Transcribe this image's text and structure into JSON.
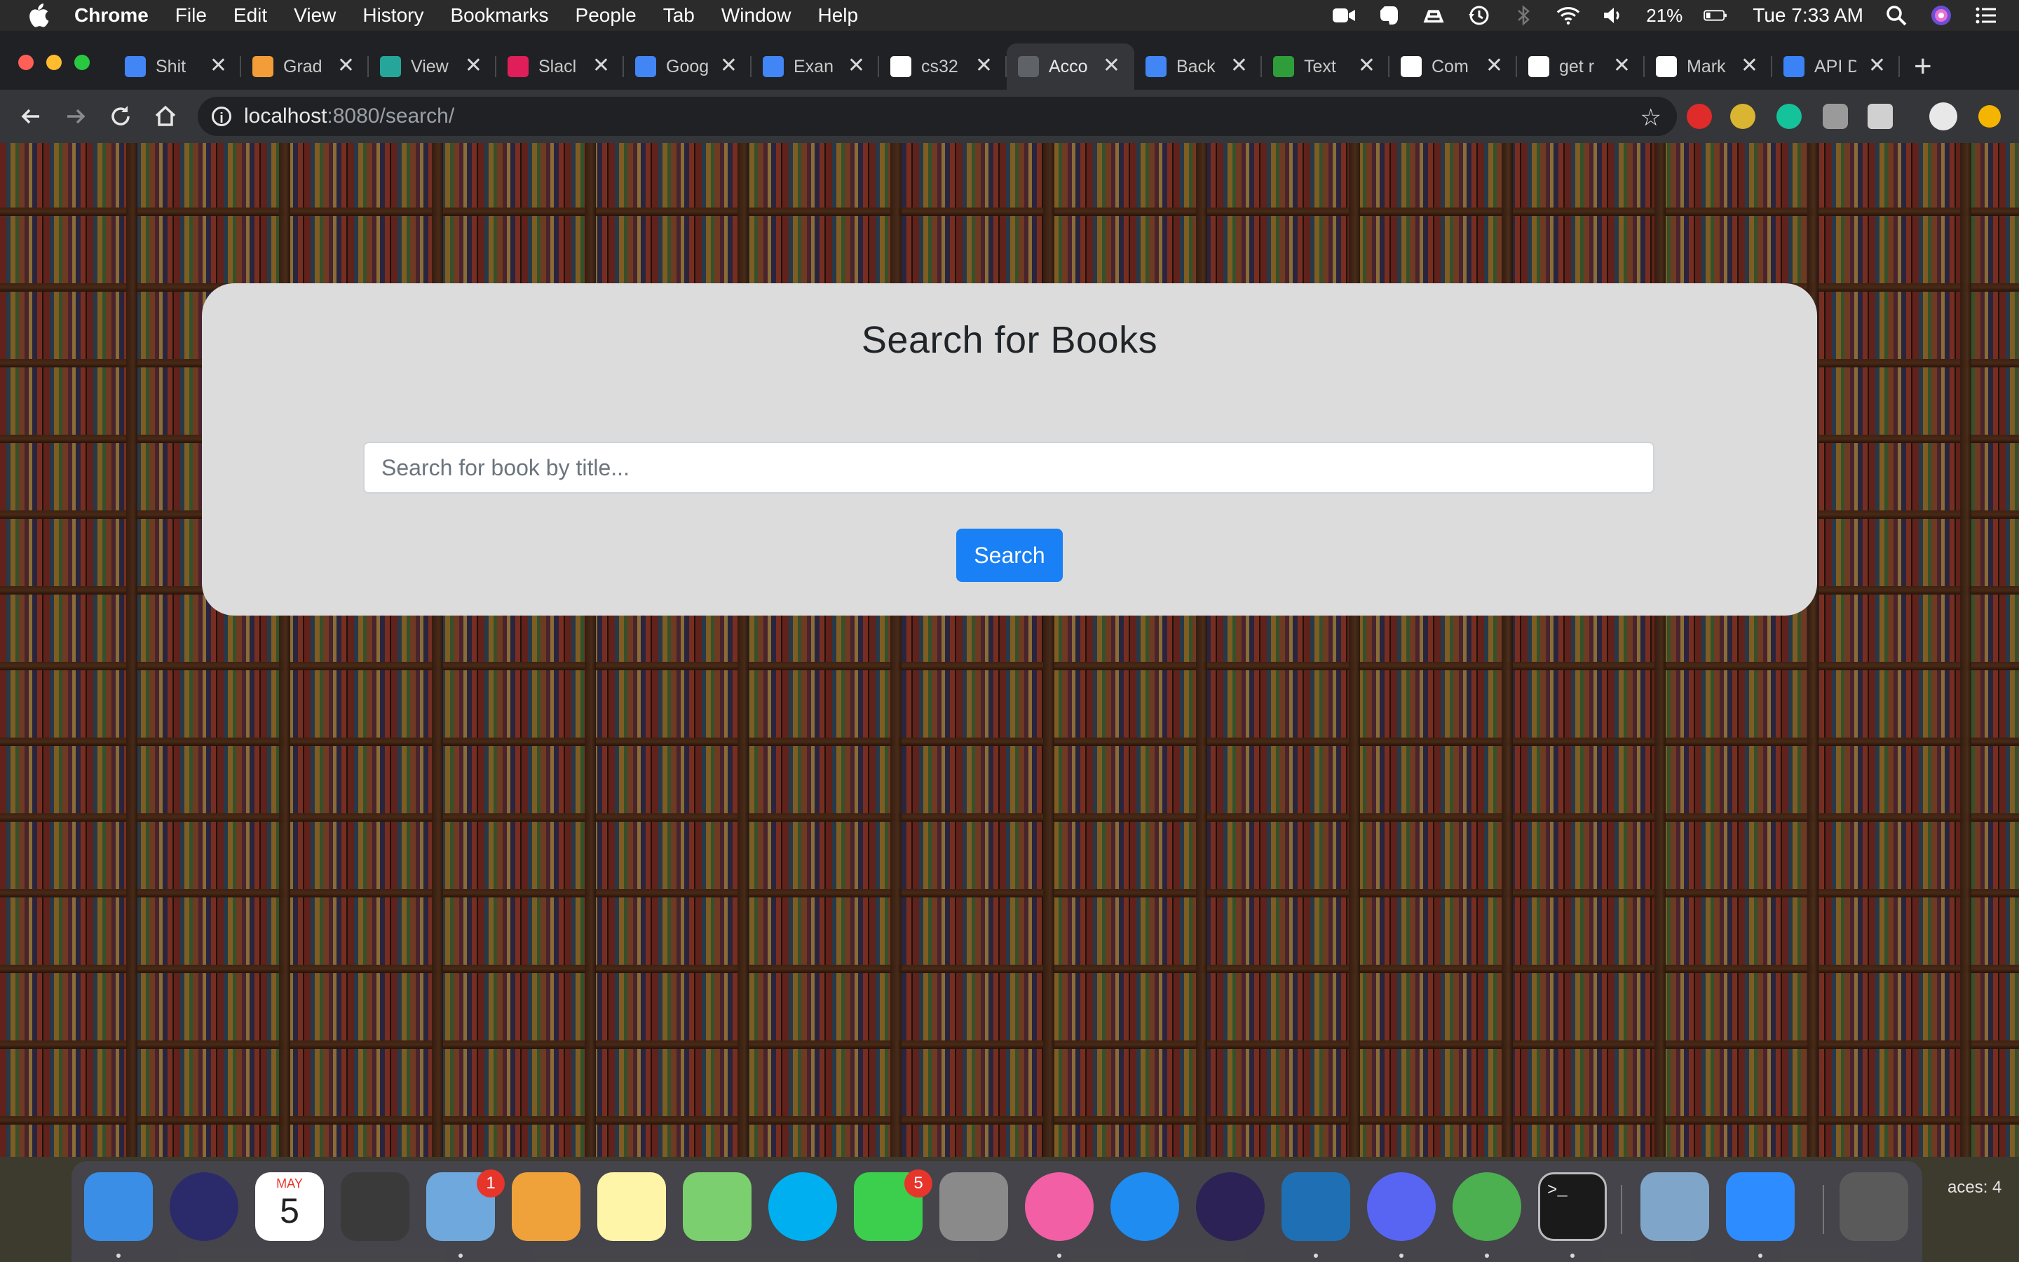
{
  "menubar": {
    "app_name": "Chrome",
    "menus": [
      "File",
      "Edit",
      "View",
      "History",
      "Bookmarks",
      "People",
      "Tab",
      "Window",
      "Help"
    ],
    "battery_percent": "21%",
    "clock": "Tue 7:33 AM",
    "status_icons": [
      "zoom-video-icon",
      "evernote-icon",
      "drive-sync-icon",
      "time-machine-icon",
      "bluetooth-icon",
      "wifi-icon",
      "volume-icon",
      "battery-icon",
      "spotlight-icon",
      "siri-icon",
      "notification-center-icon"
    ]
  },
  "browser": {
    "tabs": [
      {
        "label": "Shit",
        "icon": "google-docs-icon",
        "color": "#4285f4"
      },
      {
        "label": "Grad",
        "icon": "gradescope-icon",
        "color": "#f29d38"
      },
      {
        "label": "View",
        "icon": "analytics-icon",
        "color": "#26a69a"
      },
      {
        "label": "Slacl",
        "icon": "slack-icon",
        "color": "#e01e5a"
      },
      {
        "label": "Goog",
        "icon": "google-docs-icon",
        "color": "#4285f4"
      },
      {
        "label": "Exan",
        "icon": "google-docs-icon",
        "color": "#4285f4"
      },
      {
        "label": "cs32",
        "icon": "github-icon",
        "color": "#ffffff"
      },
      {
        "label": "Acco",
        "icon": "globe-icon",
        "color": "#5f6368",
        "active": true
      },
      {
        "label": "Back",
        "icon": "google-docs-icon",
        "color": "#4285f4"
      },
      {
        "label": "Text",
        "icon": "leaf-icon",
        "color": "#2e9d3a"
      },
      {
        "label": "Com",
        "icon": "github-icon",
        "color": "#ffffff"
      },
      {
        "label": "get r",
        "icon": "google-icon",
        "color": "#ffffff"
      },
      {
        "label": "Mark",
        "icon": "github-icon",
        "color": "#ffffff"
      },
      {
        "label": "API D",
        "icon": "api-docs-icon",
        "color": "#3b82f6"
      }
    ],
    "tab_close_glyph": "✕",
    "new_tab_glyph": "+",
    "url_host": "localhost",
    "url_path": ":8080/search/",
    "extensions": [
      "adblock-icon",
      "extension-yellow-icon",
      "grammarly-icon",
      "extension-grey-icon",
      "extension-tabs-icon"
    ]
  },
  "page": {
    "title": "Search for Books",
    "search": {
      "placeholder": "Search for book by title...",
      "value": ""
    },
    "search_button": "Search"
  },
  "dock": {
    "apps": [
      {
        "name": "finder-icon",
        "color": "#3a8ee6",
        "running": true
      },
      {
        "name": "siri-icon",
        "color": "#2b2b6b",
        "running": false
      },
      {
        "name": "calendar-icon",
        "color": "#ffffff",
        "running": false
      },
      {
        "name": "mission-control-icon",
        "color": "#3a3a3a",
        "running": false
      },
      {
        "name": "mail-icon",
        "color": "#6fa8dc",
        "running": true,
        "badge": "1"
      },
      {
        "name": "pages-icon",
        "color": "#f0a23a",
        "running": false
      },
      {
        "name": "notes-icon",
        "color": "#fff5a8",
        "running": false
      },
      {
        "name": "maps-icon",
        "color": "#7ccf6e",
        "running": false
      },
      {
        "name": "skype-icon",
        "color": "#00aff0",
        "running": false
      },
      {
        "name": "facetime-icon",
        "color": "#3ccf4e",
        "running": false,
        "badge": "5"
      },
      {
        "name": "system-preferences-icon",
        "color": "#8a8a8a",
        "running": false
      },
      {
        "name": "itunes-icon",
        "color": "#f25fa5",
        "running": true
      },
      {
        "name": "app-store-icon",
        "color": "#1e8cf0",
        "running": false
      },
      {
        "name": "eclipse-icon",
        "color": "#2c2255",
        "running": false
      },
      {
        "name": "vscode-icon",
        "color": "#1f6fb5",
        "running": true
      },
      {
        "name": "discord-icon",
        "color": "#5865f2",
        "running": true
      },
      {
        "name": "chrome-icon",
        "color": "#4caf50",
        "running": true
      },
      {
        "name": "terminal-icon",
        "color": "#1a1a1a",
        "running": true
      },
      {
        "name": "preview-icon",
        "color": "#7fa6c9",
        "running": false
      },
      {
        "name": "zoom-icon",
        "color": "#2d8cff",
        "running": true
      },
      {
        "name": "trash-icon",
        "color": "#5a5a5a",
        "running": false
      }
    ],
    "terminal_glyph": ">_",
    "calendar_month": "MAY",
    "calendar_day": "5",
    "spaces_label": "aces: 4"
  }
}
